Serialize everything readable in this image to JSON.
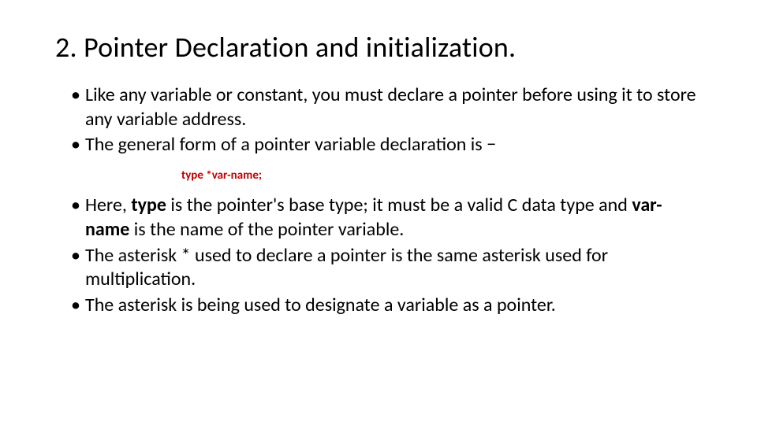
{
  "title": "2. Pointer Declaration and initialization.",
  "bullets_top": [
    "Like any variable or constant, you must declare a pointer before using it to store any variable address.",
    "The general form of a pointer variable declaration is −"
  ],
  "code": "type  *var-name;",
  "bullet3_pre": "Here, ",
  "bullet3_b1": "type",
  "bullet3_mid": " is the pointer's base type; it must be a valid C data type and ",
  "bullet3_b2": "var-name",
  "bullet3_post": " is the name of the pointer variable.",
  "bullets_bottom": [
    "The asterisk * used to declare a pointer is the same asterisk used for multiplication.",
    "The asterisk is being used to designate a variable as a pointer."
  ]
}
